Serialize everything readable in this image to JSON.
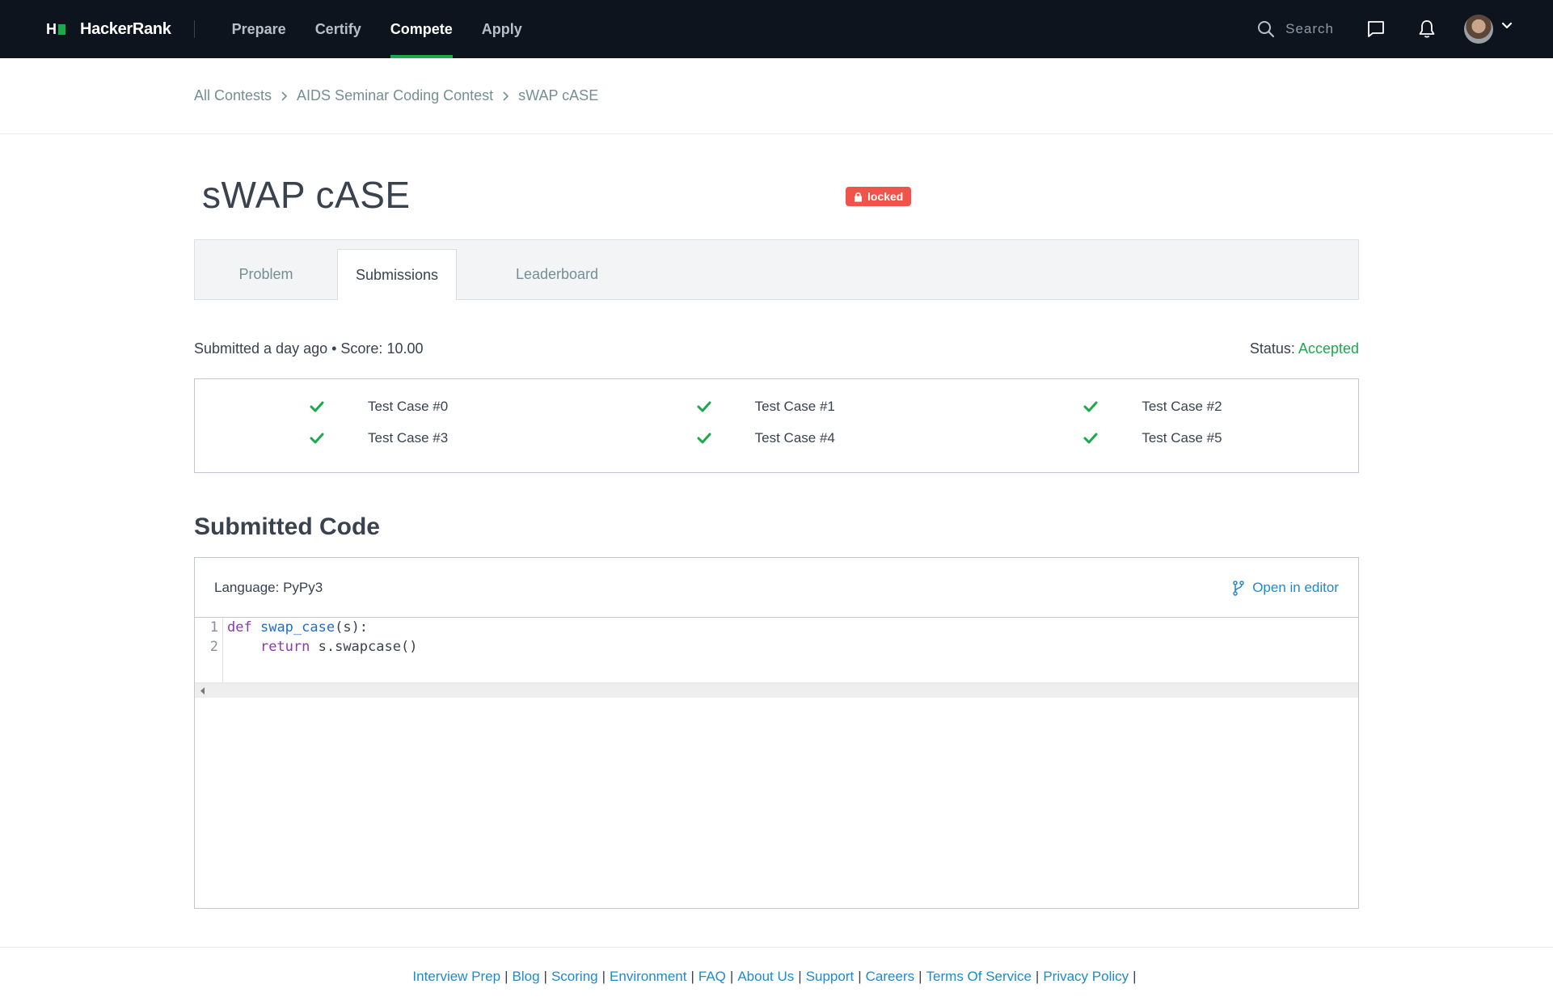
{
  "brand": {
    "mark": "H",
    "name": "HackerRank"
  },
  "nav": {
    "links": [
      {
        "label": "Prepare"
      },
      {
        "label": "Certify"
      },
      {
        "label": "Compete"
      },
      {
        "label": "Apply"
      }
    ],
    "active": "Compete",
    "search_placeholder": "Search"
  },
  "breadcrumb": [
    "All Contests",
    "AIDS Seminar Coding Contest",
    "sWAP cASE"
  ],
  "page": {
    "title": "sWAP cASE",
    "badge": "locked"
  },
  "tabs": [
    "Problem",
    "Submissions",
    "Leaderboard"
  ],
  "active_tab": "Submissions",
  "submission": {
    "summary": "Submitted a day ago • Score: 10.00",
    "status_label": "Status:",
    "status_value": "Accepted"
  },
  "test_cases": [
    {
      "label": "Test Case #0",
      "passed": true
    },
    {
      "label": "Test Case #1",
      "passed": true
    },
    {
      "label": "Test Case #2",
      "passed": true
    },
    {
      "label": "Test Case #3",
      "passed": true
    },
    {
      "label": "Test Case #4",
      "passed": true
    },
    {
      "label": "Test Case #5",
      "passed": true
    }
  ],
  "code": {
    "section_title": "Submitted Code",
    "language_label": "Language: PyPy3",
    "open_editor_label": "Open in editor",
    "line_numbers": [
      "1",
      "2"
    ],
    "lines": {
      "l1_kw": "def",
      "l1_fn": "swap_case",
      "l1_rest": "(s):",
      "l2_indent": "    ",
      "l2_kw": "return",
      "l2_rest": " s.swapcase()"
    }
  },
  "footer": [
    "Interview Prep",
    "Blog",
    "Scoring",
    "Environment",
    "FAQ",
    "About Us",
    "Support",
    "Careers",
    "Terms Of Service",
    "Privacy Policy"
  ],
  "colors": {
    "nav_bg": "#0e141e",
    "accent_green": "#1ba94c",
    "link_blue": "#1f8acb",
    "badge_red": "#f0534a"
  }
}
